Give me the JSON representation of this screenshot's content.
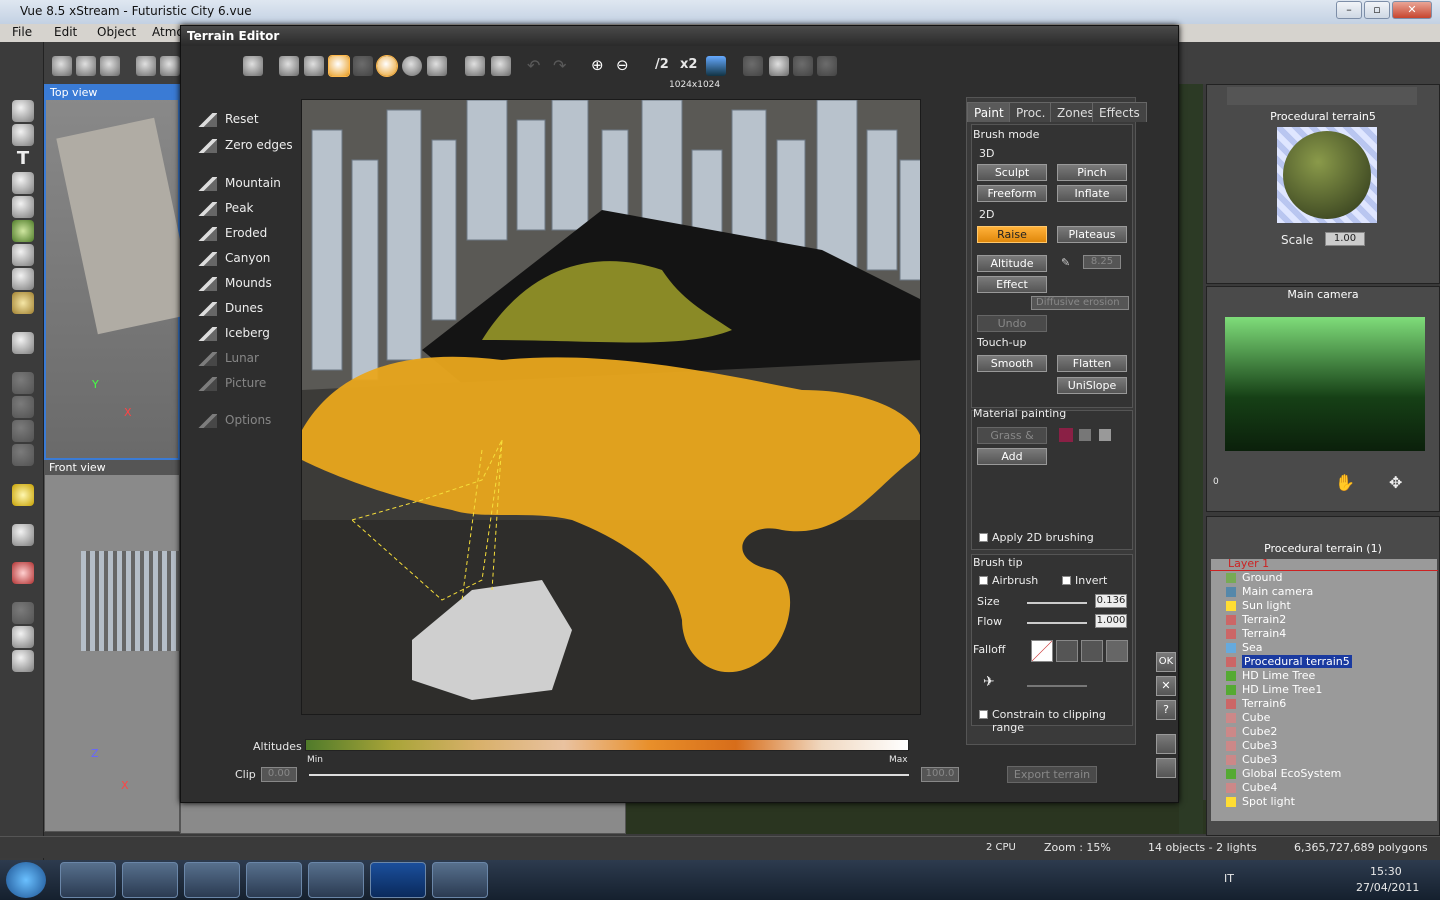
{
  "window": {
    "title": "Vue 8.5 xStream - Futuristic City 6.vue"
  },
  "menu": [
    "File",
    "Edit",
    "Object",
    "Atmo"
  ],
  "viewports": {
    "top": "Top view",
    "front": "Front view"
  },
  "editor": {
    "title": "Terrain Editor",
    "resolution": "1024x1024",
    "half": "/2",
    "double": "x2",
    "presets": [
      "Reset",
      "Zero edges",
      "Mountain",
      "Peak",
      "Eroded",
      "Canyon",
      "Mounds",
      "Dunes",
      "Iceberg",
      "Lunar",
      "Picture",
      "Options"
    ],
    "altitudes_label": "Altitudes",
    "min": "Min",
    "max": "Max",
    "clip_label": "Clip",
    "clip_min": "0.00",
    "clip_max": "100.0",
    "export": "Export terrain"
  },
  "panel": {
    "tabs": [
      "Paint",
      "Proc.",
      "Zones",
      "Effects"
    ],
    "brush_mode": "Brush mode",
    "sec3d": "3D",
    "sculpt": "Sculpt",
    "pinch": "Pinch",
    "freeform": "Freeform",
    "inflate": "Inflate",
    "sec2d": "2D",
    "raise": "Raise",
    "plateaus": "Plateaus",
    "altitude": "Altitude",
    "altitude_val": "8.25",
    "effect": "Effect",
    "effect_select": "Diffusive erosion",
    "undo": "Undo",
    "touchup": "Touch-up",
    "smooth": "Smooth",
    "flatten": "Flatten",
    "unislope": "UniSlope",
    "material": "Material painting",
    "grass": "Grass &",
    "add": "Add",
    "apply2d": "Apply 2D brushing",
    "brushtip": "Brush tip",
    "airbrush": "Airbrush",
    "invert": "Invert",
    "size": "Size",
    "size_val": "0.136",
    "flow": "Flow",
    "flow_val": "1.000",
    "falloff": "Falloff",
    "constrain": "Constrain to clipping range"
  },
  "side": {
    "ok": "OK",
    "close": "✕",
    "help": "?"
  },
  "right": {
    "mat_title": "Procedural terrain5",
    "scale_label": "Scale",
    "scale_val": "1.00",
    "cam_title": "Main camera",
    "tree_title": "Procedural terrain (1)",
    "tree": [
      "Layer 1",
      "Ground",
      "Main camera",
      "Sun light",
      "Terrain2",
      "Terrain4",
      "Sea",
      "Procedural terrain5",
      "HD Lime Tree",
      "HD Lime Tree1",
      "Terrain6",
      "Cube",
      "Cube2",
      "Cube3",
      "Cube3",
      "Global EcoSystem",
      "Cube4",
      "Spot light"
    ],
    "ruler_val": "0"
  },
  "status": {
    "cpu": "2 CPU",
    "zoom": "Zoom : 15%",
    "objects": "14 objects - 2 lights",
    "polys": "6,365,727,689 polygons"
  },
  "taskbar": {
    "lang": "IT",
    "time": "15:30",
    "date": "27/04/2011"
  },
  "colors": {
    "accent": "#f0a020",
    "selection": "#1a3aa0"
  }
}
